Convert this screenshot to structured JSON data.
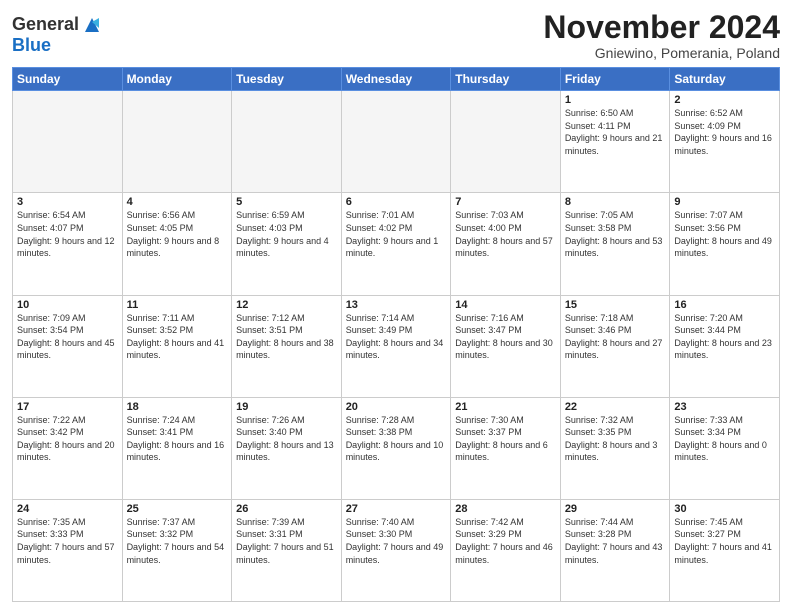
{
  "header": {
    "logo_general": "General",
    "logo_blue": "Blue",
    "main_title": "November 2024",
    "subtitle": "Gniewino, Pomerania, Poland"
  },
  "days_of_week": [
    "Sunday",
    "Monday",
    "Tuesday",
    "Wednesday",
    "Thursday",
    "Friday",
    "Saturday"
  ],
  "weeks": [
    [
      {
        "day": "",
        "info": ""
      },
      {
        "day": "",
        "info": ""
      },
      {
        "day": "",
        "info": ""
      },
      {
        "day": "",
        "info": ""
      },
      {
        "day": "",
        "info": ""
      },
      {
        "day": "1",
        "info": "Sunrise: 6:50 AM\nSunset: 4:11 PM\nDaylight: 9 hours and 21 minutes."
      },
      {
        "day": "2",
        "info": "Sunrise: 6:52 AM\nSunset: 4:09 PM\nDaylight: 9 hours and 16 minutes."
      }
    ],
    [
      {
        "day": "3",
        "info": "Sunrise: 6:54 AM\nSunset: 4:07 PM\nDaylight: 9 hours and 12 minutes."
      },
      {
        "day": "4",
        "info": "Sunrise: 6:56 AM\nSunset: 4:05 PM\nDaylight: 9 hours and 8 minutes."
      },
      {
        "day": "5",
        "info": "Sunrise: 6:59 AM\nSunset: 4:03 PM\nDaylight: 9 hours and 4 minutes."
      },
      {
        "day": "6",
        "info": "Sunrise: 7:01 AM\nSunset: 4:02 PM\nDaylight: 9 hours and 1 minute."
      },
      {
        "day": "7",
        "info": "Sunrise: 7:03 AM\nSunset: 4:00 PM\nDaylight: 8 hours and 57 minutes."
      },
      {
        "day": "8",
        "info": "Sunrise: 7:05 AM\nSunset: 3:58 PM\nDaylight: 8 hours and 53 minutes."
      },
      {
        "day": "9",
        "info": "Sunrise: 7:07 AM\nSunset: 3:56 PM\nDaylight: 8 hours and 49 minutes."
      }
    ],
    [
      {
        "day": "10",
        "info": "Sunrise: 7:09 AM\nSunset: 3:54 PM\nDaylight: 8 hours and 45 minutes."
      },
      {
        "day": "11",
        "info": "Sunrise: 7:11 AM\nSunset: 3:52 PM\nDaylight: 8 hours and 41 minutes."
      },
      {
        "day": "12",
        "info": "Sunrise: 7:12 AM\nSunset: 3:51 PM\nDaylight: 8 hours and 38 minutes."
      },
      {
        "day": "13",
        "info": "Sunrise: 7:14 AM\nSunset: 3:49 PM\nDaylight: 8 hours and 34 minutes."
      },
      {
        "day": "14",
        "info": "Sunrise: 7:16 AM\nSunset: 3:47 PM\nDaylight: 8 hours and 30 minutes."
      },
      {
        "day": "15",
        "info": "Sunrise: 7:18 AM\nSunset: 3:46 PM\nDaylight: 8 hours and 27 minutes."
      },
      {
        "day": "16",
        "info": "Sunrise: 7:20 AM\nSunset: 3:44 PM\nDaylight: 8 hours and 23 minutes."
      }
    ],
    [
      {
        "day": "17",
        "info": "Sunrise: 7:22 AM\nSunset: 3:42 PM\nDaylight: 8 hours and 20 minutes."
      },
      {
        "day": "18",
        "info": "Sunrise: 7:24 AM\nSunset: 3:41 PM\nDaylight: 8 hours and 16 minutes."
      },
      {
        "day": "19",
        "info": "Sunrise: 7:26 AM\nSunset: 3:40 PM\nDaylight: 8 hours and 13 minutes."
      },
      {
        "day": "20",
        "info": "Sunrise: 7:28 AM\nSunset: 3:38 PM\nDaylight: 8 hours and 10 minutes."
      },
      {
        "day": "21",
        "info": "Sunrise: 7:30 AM\nSunset: 3:37 PM\nDaylight: 8 hours and 6 minutes."
      },
      {
        "day": "22",
        "info": "Sunrise: 7:32 AM\nSunset: 3:35 PM\nDaylight: 8 hours and 3 minutes."
      },
      {
        "day": "23",
        "info": "Sunrise: 7:33 AM\nSunset: 3:34 PM\nDaylight: 8 hours and 0 minutes."
      }
    ],
    [
      {
        "day": "24",
        "info": "Sunrise: 7:35 AM\nSunset: 3:33 PM\nDaylight: 7 hours and 57 minutes."
      },
      {
        "day": "25",
        "info": "Sunrise: 7:37 AM\nSunset: 3:32 PM\nDaylight: 7 hours and 54 minutes."
      },
      {
        "day": "26",
        "info": "Sunrise: 7:39 AM\nSunset: 3:31 PM\nDaylight: 7 hours and 51 minutes."
      },
      {
        "day": "27",
        "info": "Sunrise: 7:40 AM\nSunset: 3:30 PM\nDaylight: 7 hours and 49 minutes."
      },
      {
        "day": "28",
        "info": "Sunrise: 7:42 AM\nSunset: 3:29 PM\nDaylight: 7 hours and 46 minutes."
      },
      {
        "day": "29",
        "info": "Sunrise: 7:44 AM\nSunset: 3:28 PM\nDaylight: 7 hours and 43 minutes."
      },
      {
        "day": "30",
        "info": "Sunrise: 7:45 AM\nSunset: 3:27 PM\nDaylight: 7 hours and 41 minutes."
      }
    ]
  ]
}
